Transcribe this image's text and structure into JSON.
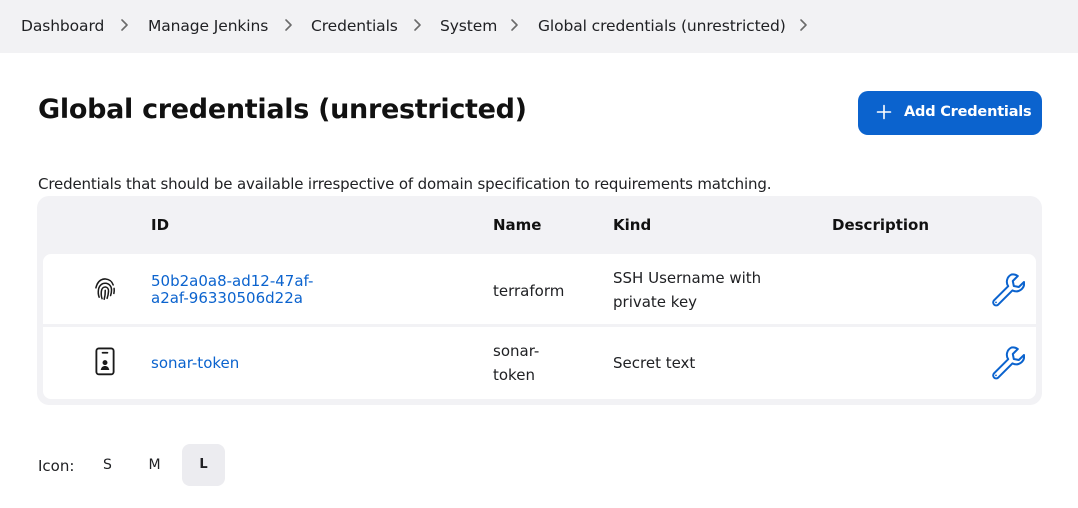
{
  "breadcrumb": {
    "items": [
      "Dashboard",
      "Manage Jenkins",
      "Credentials",
      "System",
      "Global credentials (unrestricted)"
    ]
  },
  "page": {
    "title": "Global credentials (unrestricted)",
    "add_button_label": "Add Credentials",
    "description": "Credentials that should be available irrespective of domain specification to requirements matching."
  },
  "table": {
    "headers": {
      "id": "ID",
      "name": "Name",
      "kind": "Kind",
      "description": "Description"
    },
    "rows": [
      {
        "icon": "fingerprint-icon",
        "id_line1": "50b2a0a8-ad12-47af-",
        "id_line2": "a2af-96330506d22a",
        "name": "terraform",
        "kind_line1": "SSH Username with",
        "kind_line2": "private key",
        "description": ""
      },
      {
        "icon": "id-badge-icon",
        "id_line1": "sonar-token",
        "name_line1": "sonar-",
        "name_line2": "token",
        "kind_line1": "Secret text",
        "description": ""
      }
    ]
  },
  "icon_size": {
    "label": "Icon:",
    "options": [
      "S",
      "M",
      "L"
    ],
    "selected": "L"
  },
  "colors": {
    "accent": "#0b63ce",
    "breadcrumb_bg": "#f2f2f4",
    "table_bg": "#f2f2f5"
  }
}
